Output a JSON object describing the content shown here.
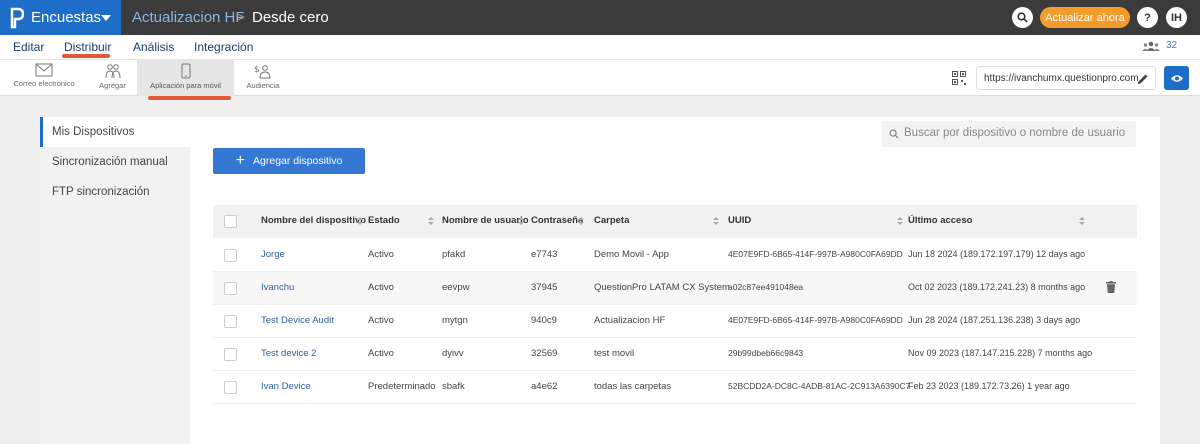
{
  "topbar": {
    "app": "Encuestas",
    "crumb1": "Actualizacion HF",
    "sep": ">",
    "crumb2": "Desde cero",
    "update_btn": "Actualizar ahora",
    "help": "?",
    "avatar": "IH"
  },
  "menu": {
    "items": [
      "Editar",
      "Distribuir",
      "Análisis",
      "Integración"
    ],
    "count": "32"
  },
  "toolbar": {
    "items": [
      "Correo electrónico",
      "Agregar",
      "Aplicación para móvil",
      "Audiencia"
    ],
    "url": "https://ivanchumx.questionpro.com"
  },
  "sidebar": {
    "items": [
      "Mis Dispositivos",
      "Sincronización manual",
      "FTP sincronización"
    ]
  },
  "search": {
    "placeholder": "Buscar por dispositivo o nombre de usuario"
  },
  "add_button": "Agregar dispositivo",
  "table": {
    "headers": [
      "Nombre del dispositivo",
      "Estado",
      "Nombre de usuario",
      "Contraseña",
      "Carpeta",
      "UUID",
      "Último acceso"
    ],
    "rows": [
      {
        "name": "Jorge",
        "status": "Activo",
        "user": "pfakd",
        "pass": "e7743",
        "folder": "Demo Movil - App",
        "uuid": "4E07E9FD-6B65-414F-997B-A980C0FA69DD",
        "last": "Jun 18 2024 (189.172.197.179) 12 days ago"
      },
      {
        "name": "Ivanchu",
        "status": "Activo",
        "user": "eevpw",
        "pass": "37945",
        "folder": "QuestionPro LATAM CX System",
        "uuid": "a02c87ee491048ea",
        "last": "Oct 02 2023 (189.172.241.23) 8 months ago"
      },
      {
        "name": "Test Device Audit",
        "status": "Activo",
        "user": "mytgn",
        "pass": "940c9",
        "folder": "Actualizacion HF",
        "uuid": "4E07E9FD-6B65-414F-997B-A980C0FA69DD",
        "last": "Jun 28 2024 (187.251.136.238) 3 days ago"
      },
      {
        "name": "Test device 2",
        "status": "Activo",
        "user": "dyivv",
        "pass": "32569",
        "folder": "test movil",
        "uuid": "29b99dbeb66c9843",
        "last": "Nov 09 2023 (187.147.215.228) 7 months ago"
      },
      {
        "name": "Ivan Device",
        "status": "Predeterminado",
        "user": "sbafk",
        "pass": "a4e62",
        "folder": "todas las carpetas",
        "uuid": "52BCDD2A-DC8C-4ADB-81AC-2C913A6390C7",
        "last": "Feb 23 2023 (189.172.73.26) 1 year ago"
      }
    ]
  }
}
